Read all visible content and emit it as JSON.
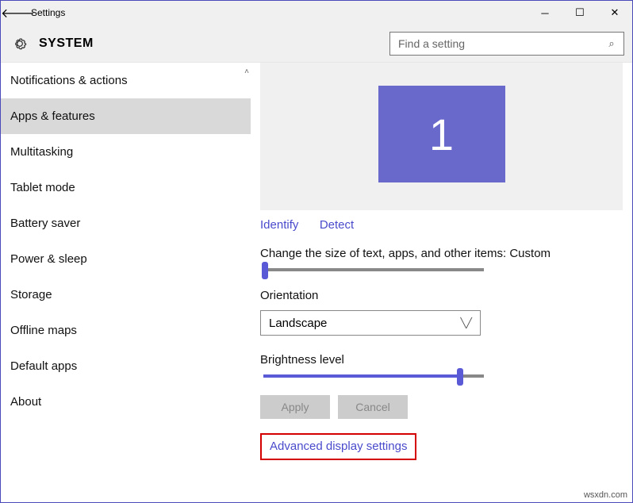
{
  "titlebar": {
    "title": "Settings"
  },
  "header": {
    "label": "SYSTEM",
    "search_placeholder": "Find a setting"
  },
  "sidebar": {
    "items": [
      {
        "label": "Notifications & actions"
      },
      {
        "label": "Apps & features"
      },
      {
        "label": "Multitasking"
      },
      {
        "label": "Tablet mode"
      },
      {
        "label": "Battery saver"
      },
      {
        "label": "Power & sleep"
      },
      {
        "label": "Storage"
      },
      {
        "label": "Offline maps"
      },
      {
        "label": "Default apps"
      },
      {
        "label": "About"
      }
    ]
  },
  "main": {
    "monitor_id": "1",
    "identify": "Identify",
    "detect": "Detect",
    "scale_label": "Change the size of text, apps, and other items: Custom",
    "orientation_label": "Orientation",
    "orientation_value": "Landscape",
    "brightness_label": "Brightness level",
    "apply": "Apply",
    "cancel": "Cancel",
    "advanced": "Advanced display settings"
  },
  "watermark": "wsxdn.com"
}
